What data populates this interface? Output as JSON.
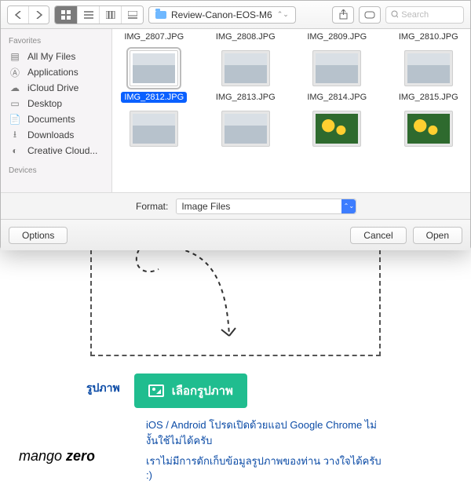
{
  "toolbar": {
    "folder_name": "Review-Canon-EOS-M6",
    "search_placeholder": "Search"
  },
  "sidebar": {
    "heading_fav": "Favorites",
    "items": [
      {
        "label": "All My Files",
        "icon": "all-files"
      },
      {
        "label": "Applications",
        "icon": "apps"
      },
      {
        "label": "iCloud Drive",
        "icon": "icloud"
      },
      {
        "label": "Desktop",
        "icon": "desktop"
      },
      {
        "label": "Documents",
        "icon": "documents"
      },
      {
        "label": "Downloads",
        "icon": "downloads"
      },
      {
        "label": "Creative Cloud...",
        "icon": "cc"
      }
    ],
    "heading_dev": "Devices"
  },
  "files": {
    "row1": [
      "IMG_2807.JPG",
      "IMG_2808.JPG",
      "IMG_2809.JPG",
      "IMG_2810.JPG"
    ],
    "row2": [
      "IMG_2812.JPG",
      "IMG_2813.JPG",
      "IMG_2814.JPG",
      "IMG_2815.JPG"
    ],
    "selected": "IMG_2812.JPG"
  },
  "format": {
    "label": "Format:",
    "value": "Image Files"
  },
  "footer": {
    "options": "Options",
    "cancel": "Cancel",
    "open": "Open"
  },
  "upload": {
    "label": "รูปภาพ",
    "button": "เลือกรูปภาพ",
    "hint1": "iOS / Android โปรดเปิดด้วยแอป Google Chrome ไม่งั้นใช้ไม่ได้ครับ",
    "hint2": "เราไม่มีการดักเก็บข้อมูลรูปภาพของท่าน วางใจได้ครับ :)"
  },
  "brand": {
    "part1": "mango ",
    "part2": "zer",
    "part3": "o"
  }
}
